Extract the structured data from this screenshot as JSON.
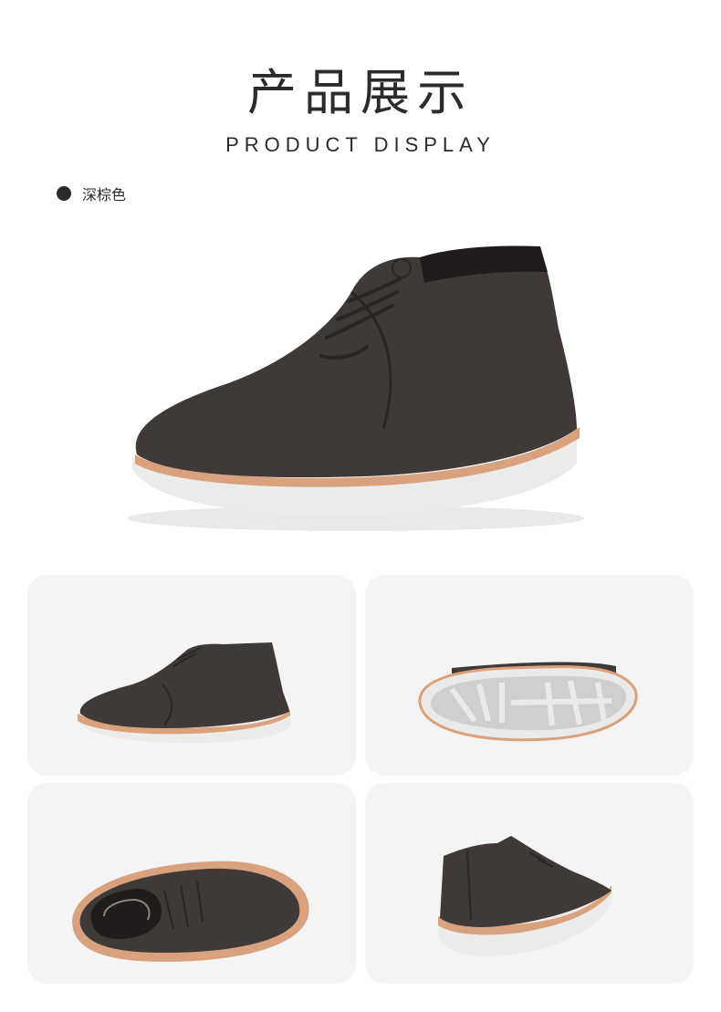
{
  "header": {
    "title_cn": "产品展示",
    "title_en": "PRODUCT DISPLAY"
  },
  "color_option": {
    "label": "深棕色",
    "swatch_color": "#2b2a2a"
  },
  "colors": {
    "upper": "#3f3a38",
    "upper_dark": "#2f2b29",
    "welt": "#d9a27e",
    "sole": "#ececea",
    "tile_bg": "#f4f4f4"
  },
  "gallery": [
    {
      "name": "side-view"
    },
    {
      "name": "sole-view"
    },
    {
      "name": "top-view"
    },
    {
      "name": "rear-view"
    }
  ]
}
